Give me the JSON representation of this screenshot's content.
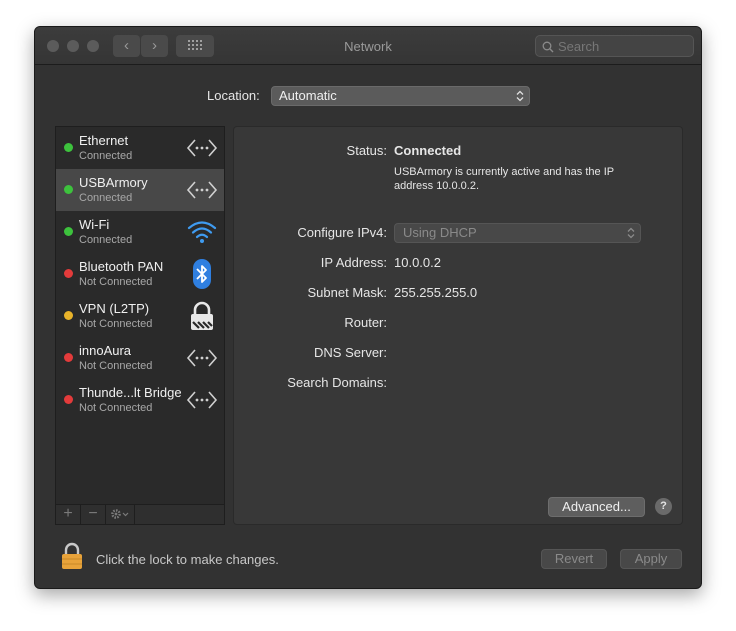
{
  "window": {
    "title": "Network"
  },
  "search": {
    "placeholder": "Search"
  },
  "location": {
    "label": "Location:",
    "value": "Automatic"
  },
  "services": [
    {
      "name": "Ethernet",
      "status": "Connected",
      "status_color": "#3dc23d",
      "icon": "ethernet-icon"
    },
    {
      "name": "USBArmory",
      "status": "Connected",
      "status_color": "#3dc23d",
      "icon": "ethernet-icon"
    },
    {
      "name": "Wi-Fi",
      "status": "Connected",
      "status_color": "#3dc23d",
      "icon": "wifi-icon"
    },
    {
      "name": "Bluetooth PAN",
      "status": "Not Connected",
      "status_color": "#e33b3b",
      "icon": "bluetooth-icon"
    },
    {
      "name": "VPN (L2TP)",
      "status": "Not Connected",
      "status_color": "#e8b32a",
      "icon": "vpn-lock-icon"
    },
    {
      "name": "innoAura",
      "status": "Not Connected",
      "status_color": "#e33b3b",
      "icon": "ethernet-icon"
    },
    {
      "name": "Thunde...lt Bridge",
      "status": "Not Connected",
      "status_color": "#e33b3b",
      "icon": "ethernet-icon"
    }
  ],
  "sidebar_toolbar": {
    "add": "+",
    "remove": "−"
  },
  "detail": {
    "status_label": "Status:",
    "status_value": "Connected",
    "status_description": "USBArmory is currently active and has the IP address 10.0.0.2.",
    "configure_label": "Configure IPv4:",
    "configure_value": "Using DHCP",
    "ip_label": "IP Address:",
    "ip_value": "10.0.0.2",
    "subnet_label": "Subnet Mask:",
    "subnet_value": "255.255.255.0",
    "router_label": "Router:",
    "dns_label": "DNS Server:",
    "search_domains_label": "Search Domains:",
    "advanced_label": "Advanced...",
    "help_label": "?"
  },
  "footer": {
    "lock_text": "Click the lock to make changes.",
    "revert_label": "Revert",
    "apply_label": "Apply"
  },
  "colors": {
    "accent_selected": "#484848",
    "lock": "#e8a33a",
    "connected": "#3dc23d",
    "disconnected": "#e33b3b",
    "pending": "#e8b32a"
  }
}
